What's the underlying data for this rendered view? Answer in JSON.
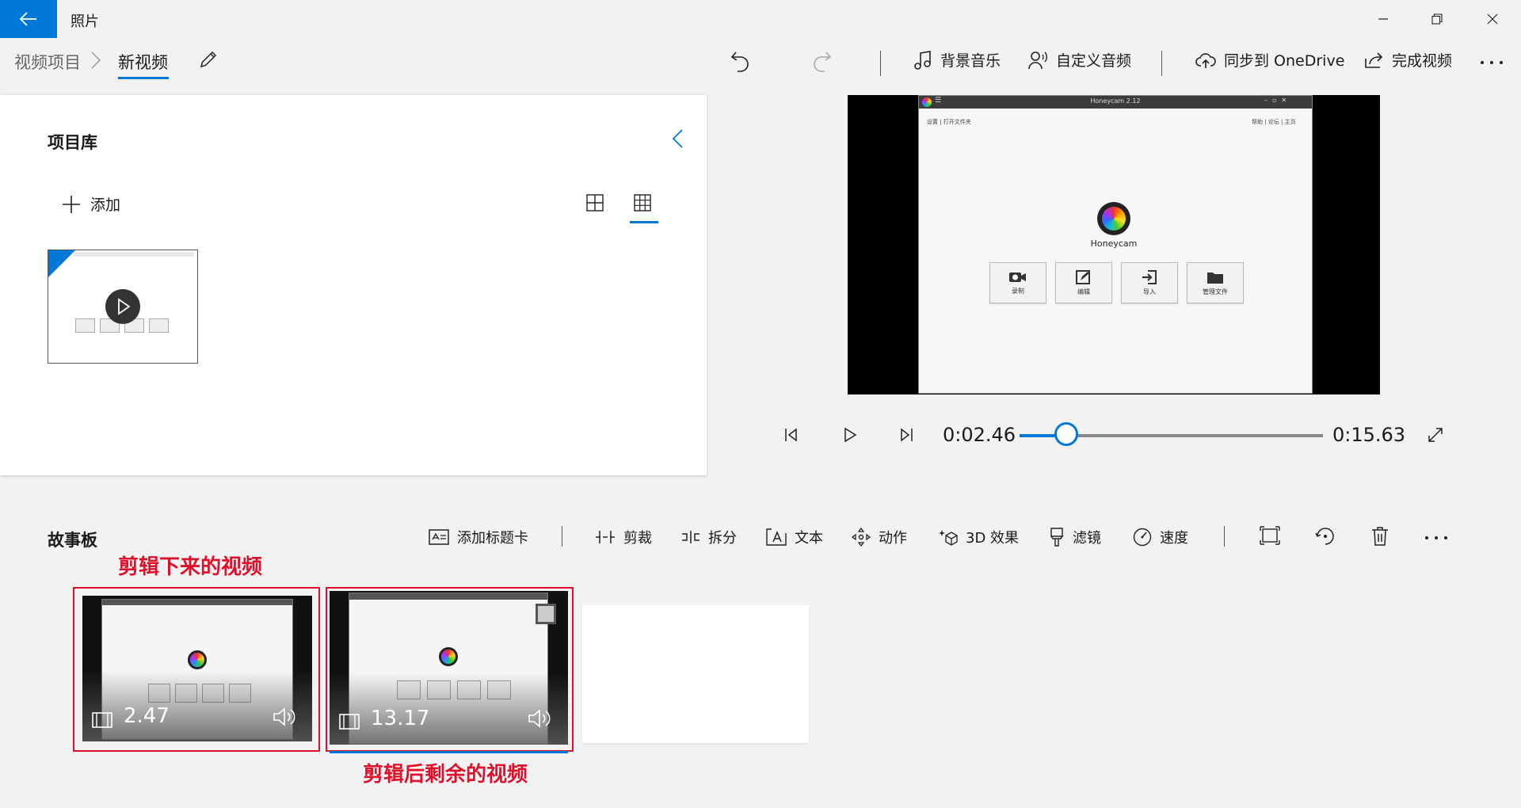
{
  "app": {
    "title": "照片"
  },
  "window": {
    "minimize_icon": "minimize-icon",
    "restore_icon": "restore-icon",
    "close_icon": "close-icon"
  },
  "breadcrumb": {
    "root": "视频项目",
    "current": "新视频"
  },
  "toolbar": {
    "background_music": "背景音乐",
    "custom_audio": "自定义音频",
    "sync_onedrive": "同步到 OneDrive",
    "finish_video": "完成视频"
  },
  "library": {
    "title": "项目库",
    "add_label": "添加"
  },
  "preview": {
    "window_title": "Honeycam 2.12",
    "menu_left": "设置 | 打开文件夹",
    "menu_right": "帮助 | 论坛 | 主页",
    "app_name": "Honeycam",
    "buttons": [
      "录制",
      "编辑",
      "导入",
      "管理文件"
    ]
  },
  "playback": {
    "current_time": "0:02.46",
    "total_time": "0:15.63",
    "progress": 0.155
  },
  "storyboard": {
    "title": "故事板",
    "tools": {
      "add_title_card": "添加标题卡",
      "trim": "剪裁",
      "split": "拆分",
      "text": "文本",
      "motion": "动作",
      "effects_3d": "3D 效果",
      "filters": "滤镜",
      "speed": "速度"
    },
    "clips": [
      {
        "duration": "2.47"
      },
      {
        "duration": "13.17"
      }
    ]
  },
  "annotations": {
    "clip1_label": "剪辑下来的视频",
    "clip2_label": "剪辑后剩余的视频"
  },
  "colors": {
    "accent": "#0078d7",
    "annotation": "#e0102a"
  }
}
